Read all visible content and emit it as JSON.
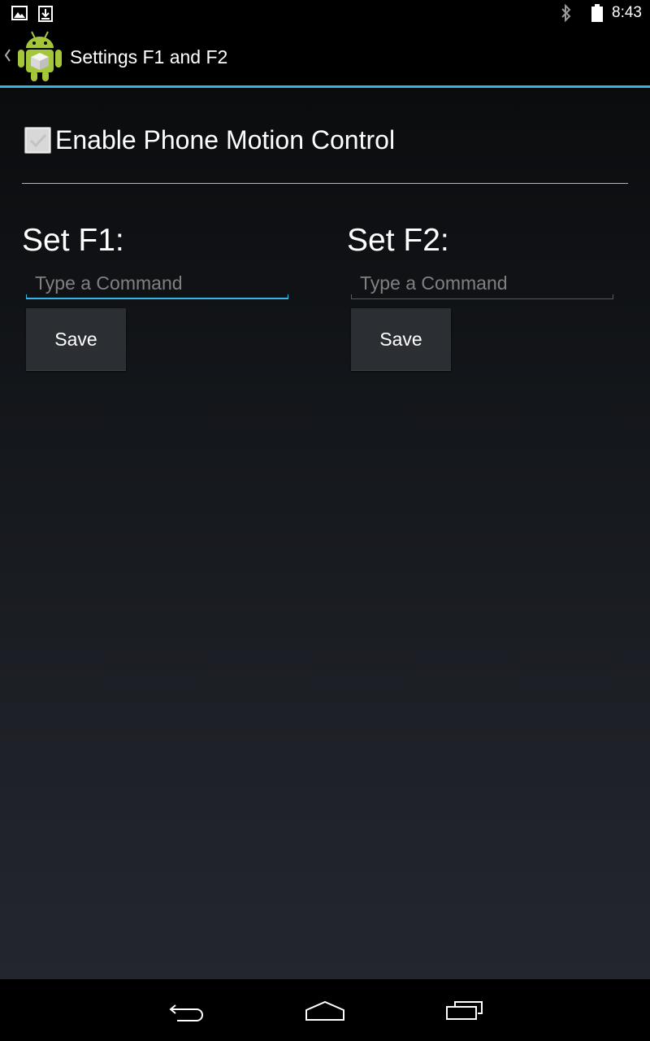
{
  "status_bar": {
    "time": "8:43",
    "left_icons": [
      "gallery-notification-icon",
      "download-notification-icon"
    ],
    "right_icons": [
      "bluetooth-icon",
      "battery-icon"
    ]
  },
  "action_bar": {
    "title": "Settings F1 and F2",
    "accent_color": "#33b5e5",
    "icons": [
      "up-caret-icon",
      "android-app-icon"
    ]
  },
  "motion_control": {
    "label": "Enable Phone Motion Control",
    "checked": true
  },
  "f1": {
    "label": "Set F1:",
    "placeholder": "Type a Command",
    "value": "",
    "focused": true,
    "save_label": "Save"
  },
  "f2": {
    "label": "Set F2:",
    "placeholder": "Type a Command",
    "value": "",
    "focused": false,
    "save_label": "Save"
  },
  "nav_bar": {
    "buttons": [
      "back-icon",
      "home-icon",
      "recent-apps-icon"
    ]
  }
}
